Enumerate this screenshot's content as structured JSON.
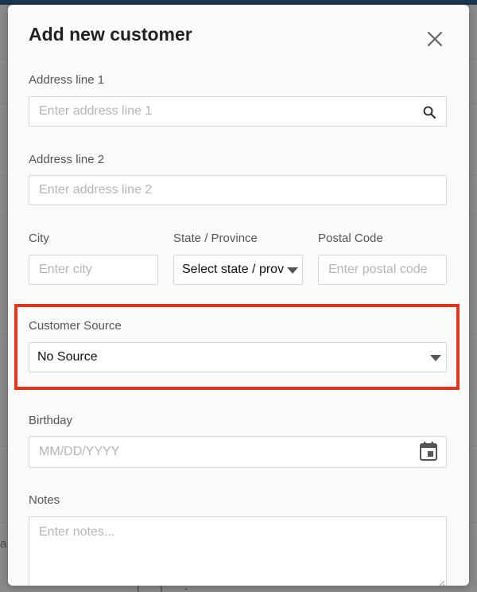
{
  "modal": {
    "title": "Add new customer"
  },
  "form": {
    "address_line_1": {
      "label": "Address line 1",
      "placeholder": "Enter address line 1",
      "value": ""
    },
    "address_line_2": {
      "label": "Address line 2",
      "placeholder": "Enter address line 2",
      "value": ""
    },
    "city": {
      "label": "City",
      "placeholder": "Enter city",
      "value": ""
    },
    "state": {
      "label": "State / Province",
      "selected": "Select state / province"
    },
    "postal_code": {
      "label": "Postal Code",
      "placeholder": "Enter postal code",
      "value": ""
    },
    "customer_source": {
      "label": "Customer Source",
      "selected": "No Source"
    },
    "birthday": {
      "label": "Birthday",
      "placeholder": "MM/DD/YYYY",
      "value": ""
    },
    "notes": {
      "label": "Notes",
      "placeholder": "Enter notes...",
      "value": ""
    }
  },
  "backdrop": {
    "left_fragment": "a",
    "bottom_fragment": "(___) ___-____"
  },
  "colors": {
    "highlight": "#e8341c",
    "topbar": "#1c3550"
  },
  "icons": {
    "close": "close-icon",
    "search": "search-icon",
    "calendar": "calendar-icon",
    "dropdown": "chevron-down-icon"
  }
}
